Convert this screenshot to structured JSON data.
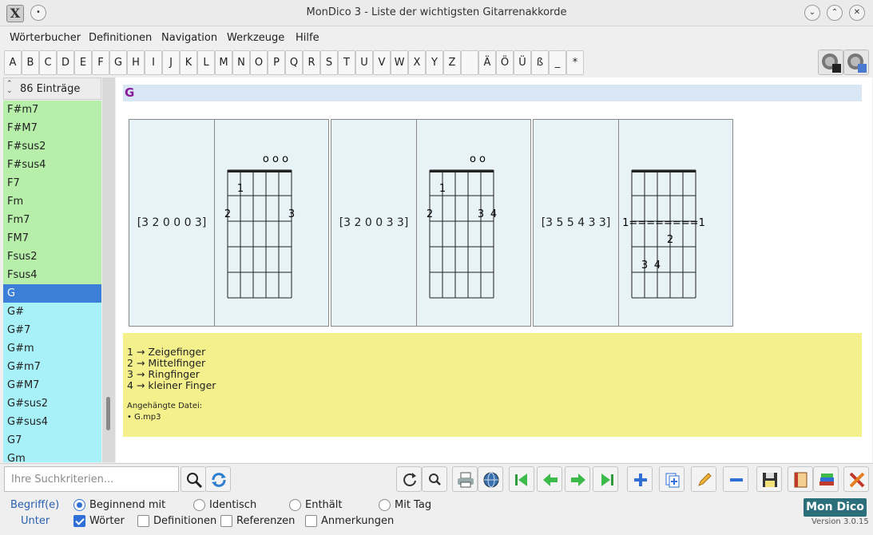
{
  "window": {
    "title": "MonDico 3 - Liste der wichtigsten Gitarrenakkorde"
  },
  "menu": [
    "Wörterbucher",
    "Definitionen",
    "Navigation",
    "Werkzeuge",
    "Hilfe"
  ],
  "letters": [
    "A",
    "B",
    "C",
    "D",
    "E",
    "F",
    "G",
    "H",
    "I",
    "J",
    "K",
    "L",
    "M",
    "N",
    "O",
    "P",
    "Q",
    "R",
    "S",
    "T",
    "U",
    "V",
    "W",
    "X",
    "Y",
    "Z",
    "",
    "Ä",
    "Ö",
    "Ü",
    "ß",
    "_",
    "*"
  ],
  "list": {
    "count_label": "86 Einträge",
    "items": [
      {
        "label": "F#m7",
        "color": "green"
      },
      {
        "label": "F#M7",
        "color": "green"
      },
      {
        "label": "F#sus2",
        "color": "green"
      },
      {
        "label": "F#sus4",
        "color": "green"
      },
      {
        "label": "F7",
        "color": "green"
      },
      {
        "label": "Fm",
        "color": "green"
      },
      {
        "label": "Fm7",
        "color": "green"
      },
      {
        "label": "FM7",
        "color": "green"
      },
      {
        "label": "Fsus2",
        "color": "green"
      },
      {
        "label": "Fsus4",
        "color": "green"
      },
      {
        "label": "G",
        "color": "selected"
      },
      {
        "label": "G#",
        "color": "cyan"
      },
      {
        "label": "G#7",
        "color": "cyan"
      },
      {
        "label": "G#m",
        "color": "cyan"
      },
      {
        "label": "G#m7",
        "color": "cyan"
      },
      {
        "label": "G#M7",
        "color": "cyan"
      },
      {
        "label": "G#sus2",
        "color": "cyan"
      },
      {
        "label": "G#sus4",
        "color": "cyan"
      },
      {
        "label": "G7",
        "color": "cyan"
      },
      {
        "label": "Gm",
        "color": "cyan"
      }
    ]
  },
  "entry": {
    "title": "G",
    "chords": [
      {
        "position": "[3 2 0 0 0 3]",
        "open_strings": "o o o",
        "fingers": [
          {
            "label": "1",
            "string": 2,
            "fret": 2
          },
          {
            "label": "2",
            "string": 1,
            "fret": 3
          },
          {
            "label": "3",
            "string": 6,
            "fret": 3
          }
        ]
      },
      {
        "position": "[3 2 0 0 3 3]",
        "open_strings": "o o",
        "fingers": [
          {
            "label": "1",
            "string": 2,
            "fret": 2
          },
          {
            "label": "2",
            "string": 1,
            "fret": 3
          },
          {
            "label": "3",
            "string": 5,
            "fret": 3
          },
          {
            "label": "4",
            "string": 6,
            "fret": 3
          }
        ]
      },
      {
        "position": "[3 5 5 4 3 3]",
        "open_strings": "",
        "barre": "1========1",
        "fingers": [
          {
            "label": "2",
            "string": 4,
            "fret": 4
          },
          {
            "label": "3",
            "string": 2,
            "fret": 5
          },
          {
            "label": "4",
            "string": 3,
            "fret": 5
          }
        ]
      }
    ],
    "finger_legend": [
      "1 → Zeigefinger",
      "2 → Mittelfinger",
      "3 → Ringfinger",
      "4 → kleiner Finger"
    ],
    "attachment_label": "Angehängte Datei:",
    "attachment_file": "• G.mp3"
  },
  "search": {
    "placeholder": "Ihre Suchkriterien..."
  },
  "options": {
    "begriff_label": "Begriff(e)",
    "unter_label": "Unter",
    "radios": [
      {
        "label": "Beginnend mit",
        "checked": true
      },
      {
        "label": "Identisch",
        "checked": false
      },
      {
        "label": "Enthält",
        "checked": false
      },
      {
        "label": "Mit Tag",
        "checked": false
      }
    ],
    "checks": [
      {
        "label": "Wörter",
        "checked": true
      },
      {
        "label": "Definitionen",
        "checked": false
      },
      {
        "label": "Referenzen",
        "checked": false
      },
      {
        "label": "Anmerkungen",
        "checked": false
      }
    ]
  },
  "branding": {
    "logo": "Mon Dico",
    "version": "Version 3.0.15"
  },
  "colors": {
    "selected": "#3b7fd8",
    "green": "#b6eeaa",
    "cyan": "#a8f1f8",
    "notes": "#f4f18d",
    "header": "#d9e6f4"
  }
}
